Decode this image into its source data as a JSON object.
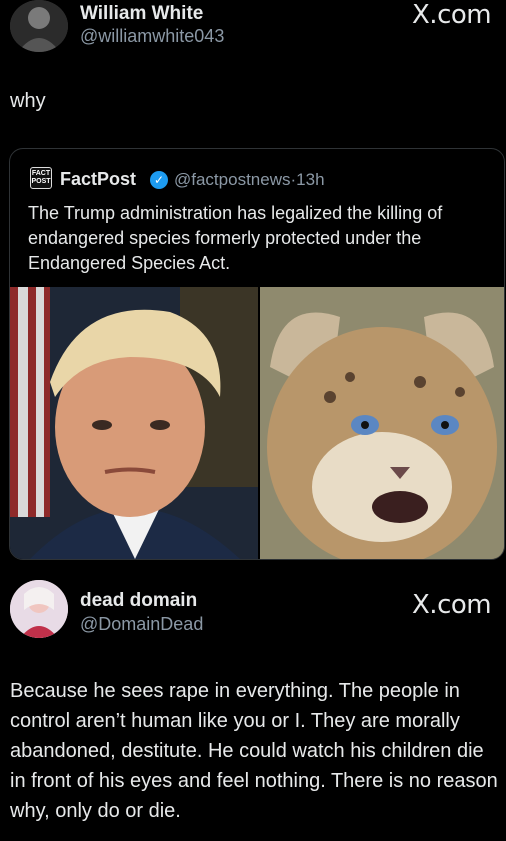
{
  "post": {
    "author_name": "William White",
    "author_handle": "@williamwhite043",
    "brand": "X.com",
    "text": "why"
  },
  "quote": {
    "author_name": "FactPost",
    "author_handle": "@factpostnews",
    "time": "13h",
    "text": "The Trump administration has legalized the killing of endangered species formerly protected under the Endangered Species Act."
  },
  "reply": {
    "author_name": "dead domain",
    "author_handle": "@DomainDead",
    "brand": "X.com",
    "text": "Because he sees rape in everything. The people in control aren’t human like you or I. They are morally abandoned, destitute. He could watch his children die in front of his eyes and feel nothing. There is no reason why, only do or die."
  },
  "colors": {
    "background": "#000000",
    "text": "#e7e9ea",
    "muted": "#8b98a5",
    "verified": "#1d9bf0",
    "border": "#2f3336"
  }
}
